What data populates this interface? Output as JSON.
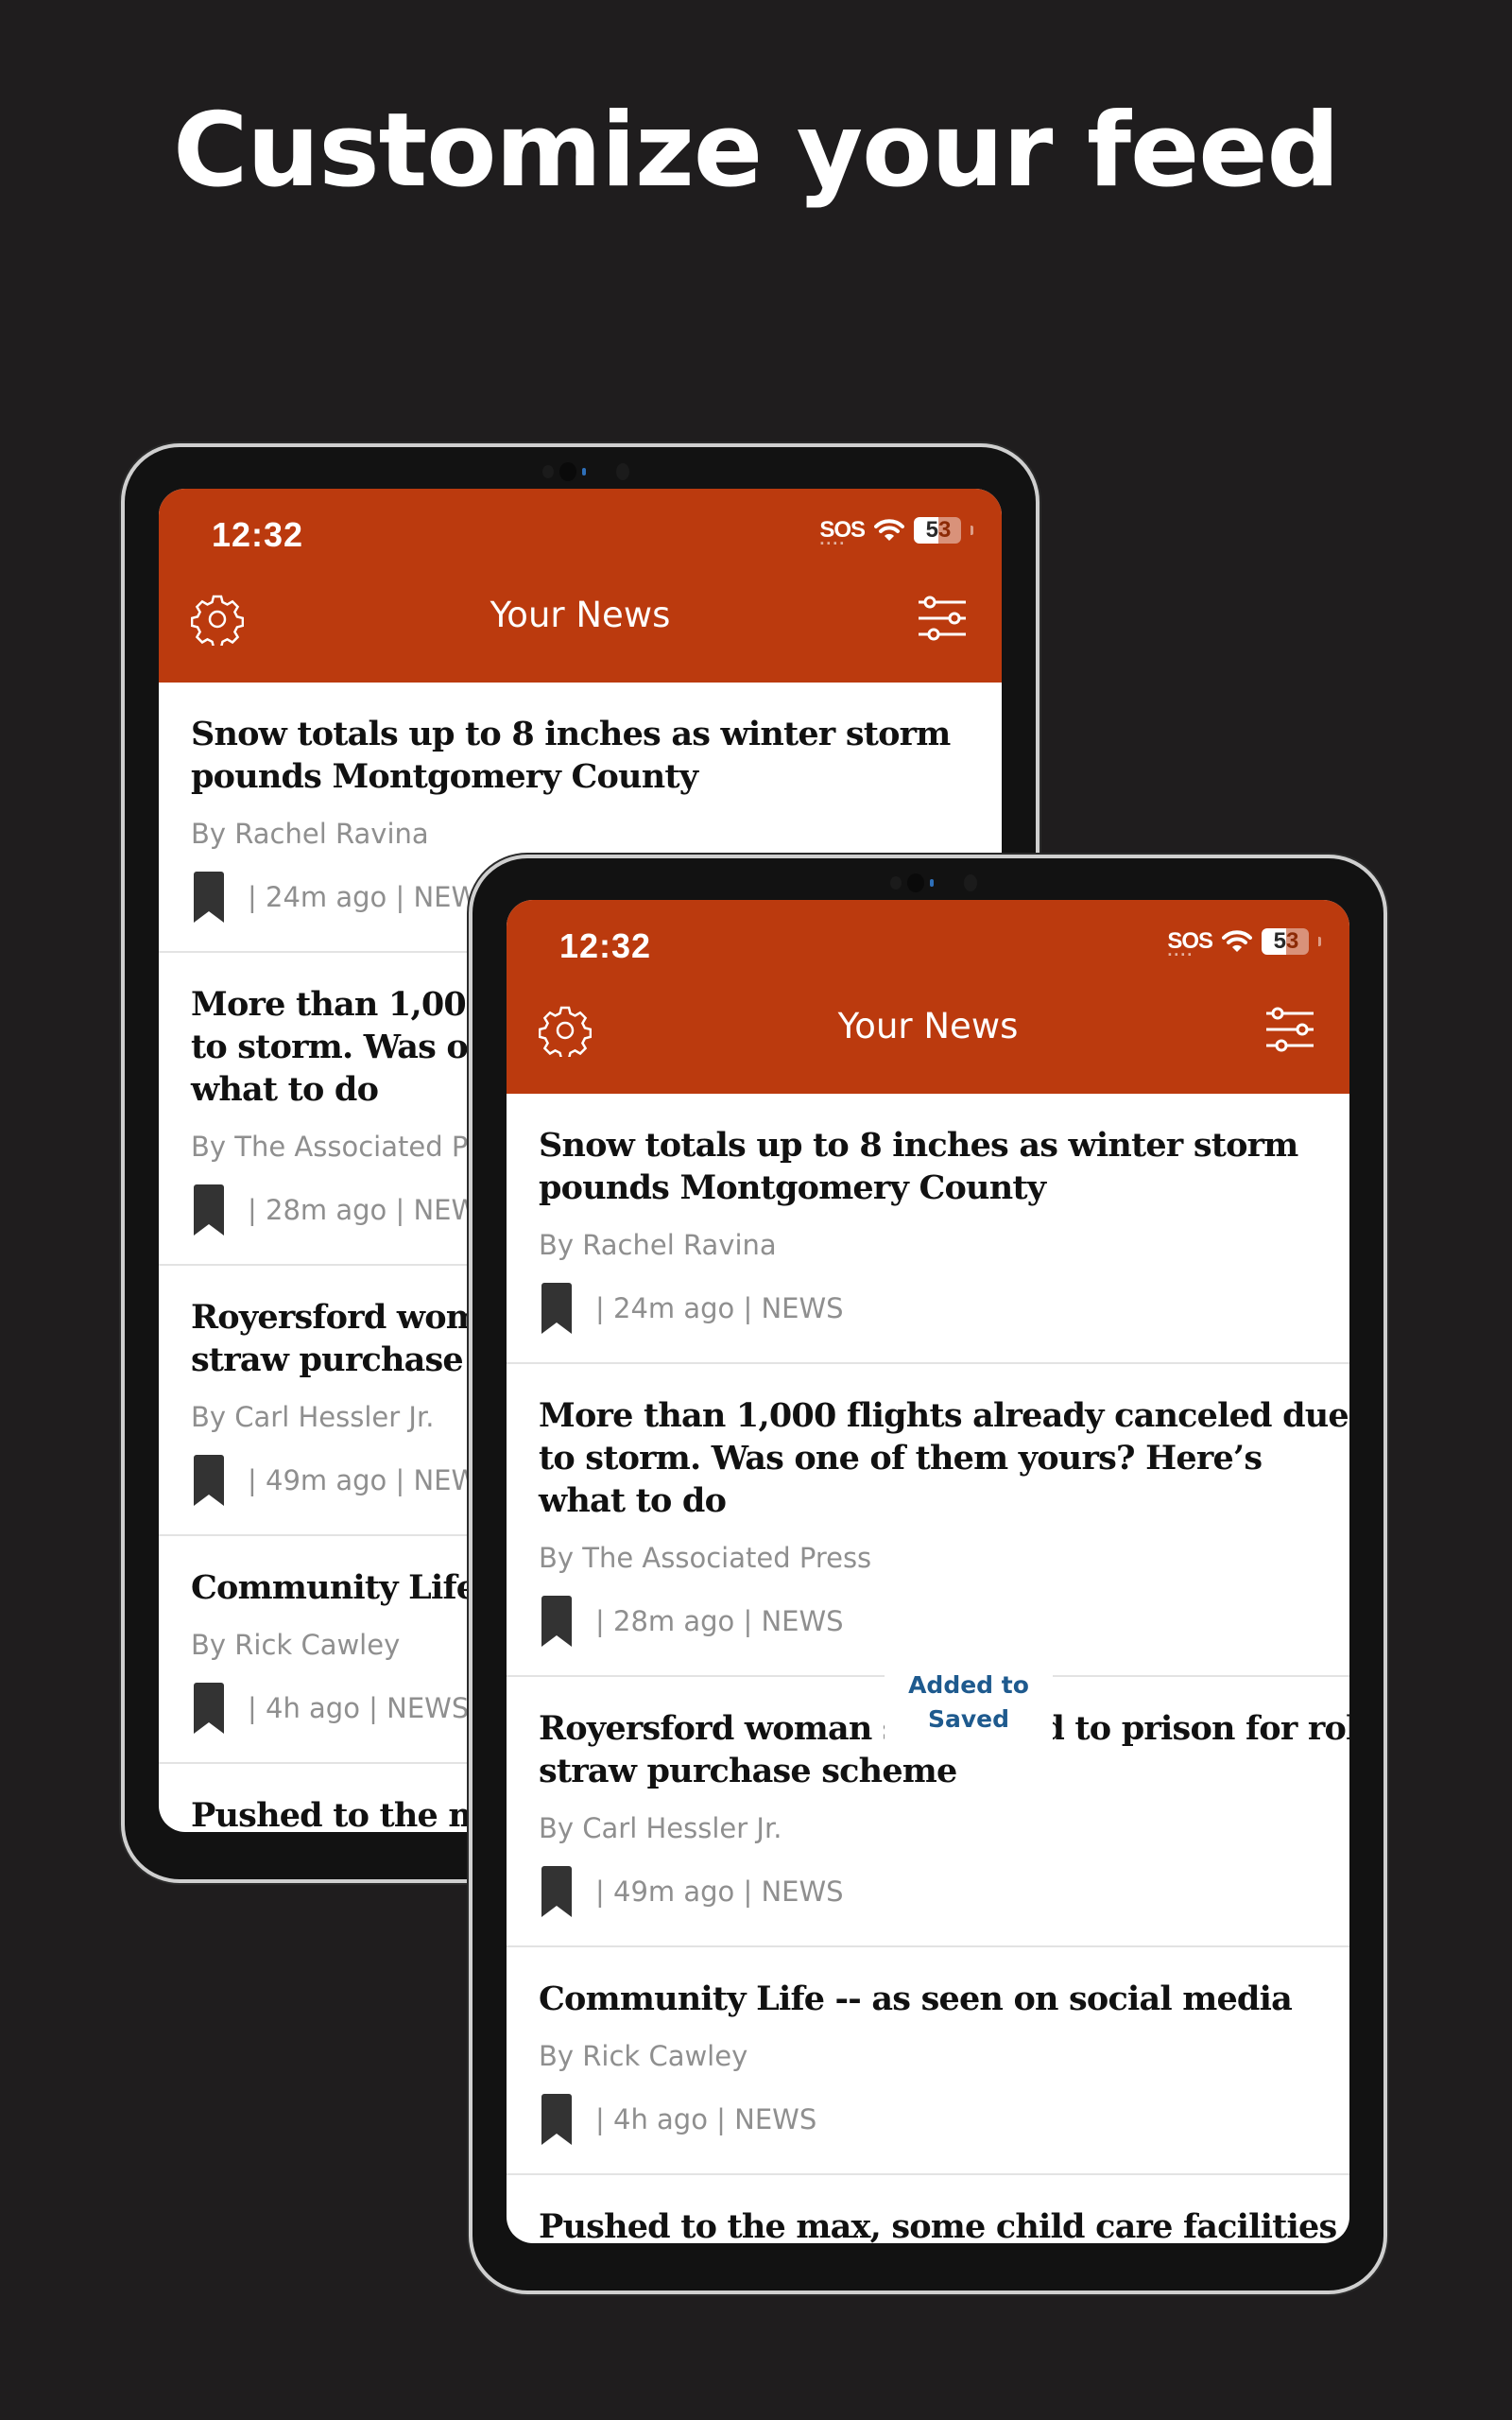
{
  "headline": "Customize your feed",
  "colors": {
    "brand": "#bb3a0e",
    "background": "#1f1d1e",
    "toast_text": "#1e5a8e"
  },
  "status_bar": {
    "time": "12:32",
    "carrier": "SOS",
    "battery_level": "53",
    "battery_digit_1": "5",
    "battery_digit_2": "3",
    "wifi_icon": "wifi-icon"
  },
  "app_bar": {
    "title": "Your News",
    "left_icon": "gear-icon",
    "right_icon": "sliders-icon"
  },
  "articles": [
    {
      "title_line1": "Snow totals up to 8 inches as winter storm",
      "title_line2": "pounds Montgomery County",
      "title_line3": "",
      "byline": "By Rachel Ravina",
      "meta": "| 24m ago | NEWS"
    },
    {
      "title_line1": "More than 1,000 flights already canceled due",
      "title_line2": "to storm. Was one of them yours? Here’s",
      "title_line3": "what to do",
      "byline": "By The Associated Press",
      "meta": "| 28m ago | NEWS"
    },
    {
      "title_line1": "Royersford woman sentenced to prison for role in",
      "title_line2": "straw purchase scheme",
      "title_line3": "",
      "byline": "By Carl Hessler Jr.",
      "meta": "| 49m ago | NEWS"
    },
    {
      "title_line1": "Community Life -- as seen on social media",
      "title_line2": "",
      "title_line3": "",
      "byline": "By Rick Cawley",
      "meta": "| 4h ago | NEWS"
    },
    {
      "title_line1": "Pushed to the max, some child care facilities",
      "title_line2": "",
      "title_line3": "",
      "byline": "",
      "meta": ""
    }
  ],
  "toast": {
    "line1": "Added to",
    "line2": "Saved"
  }
}
